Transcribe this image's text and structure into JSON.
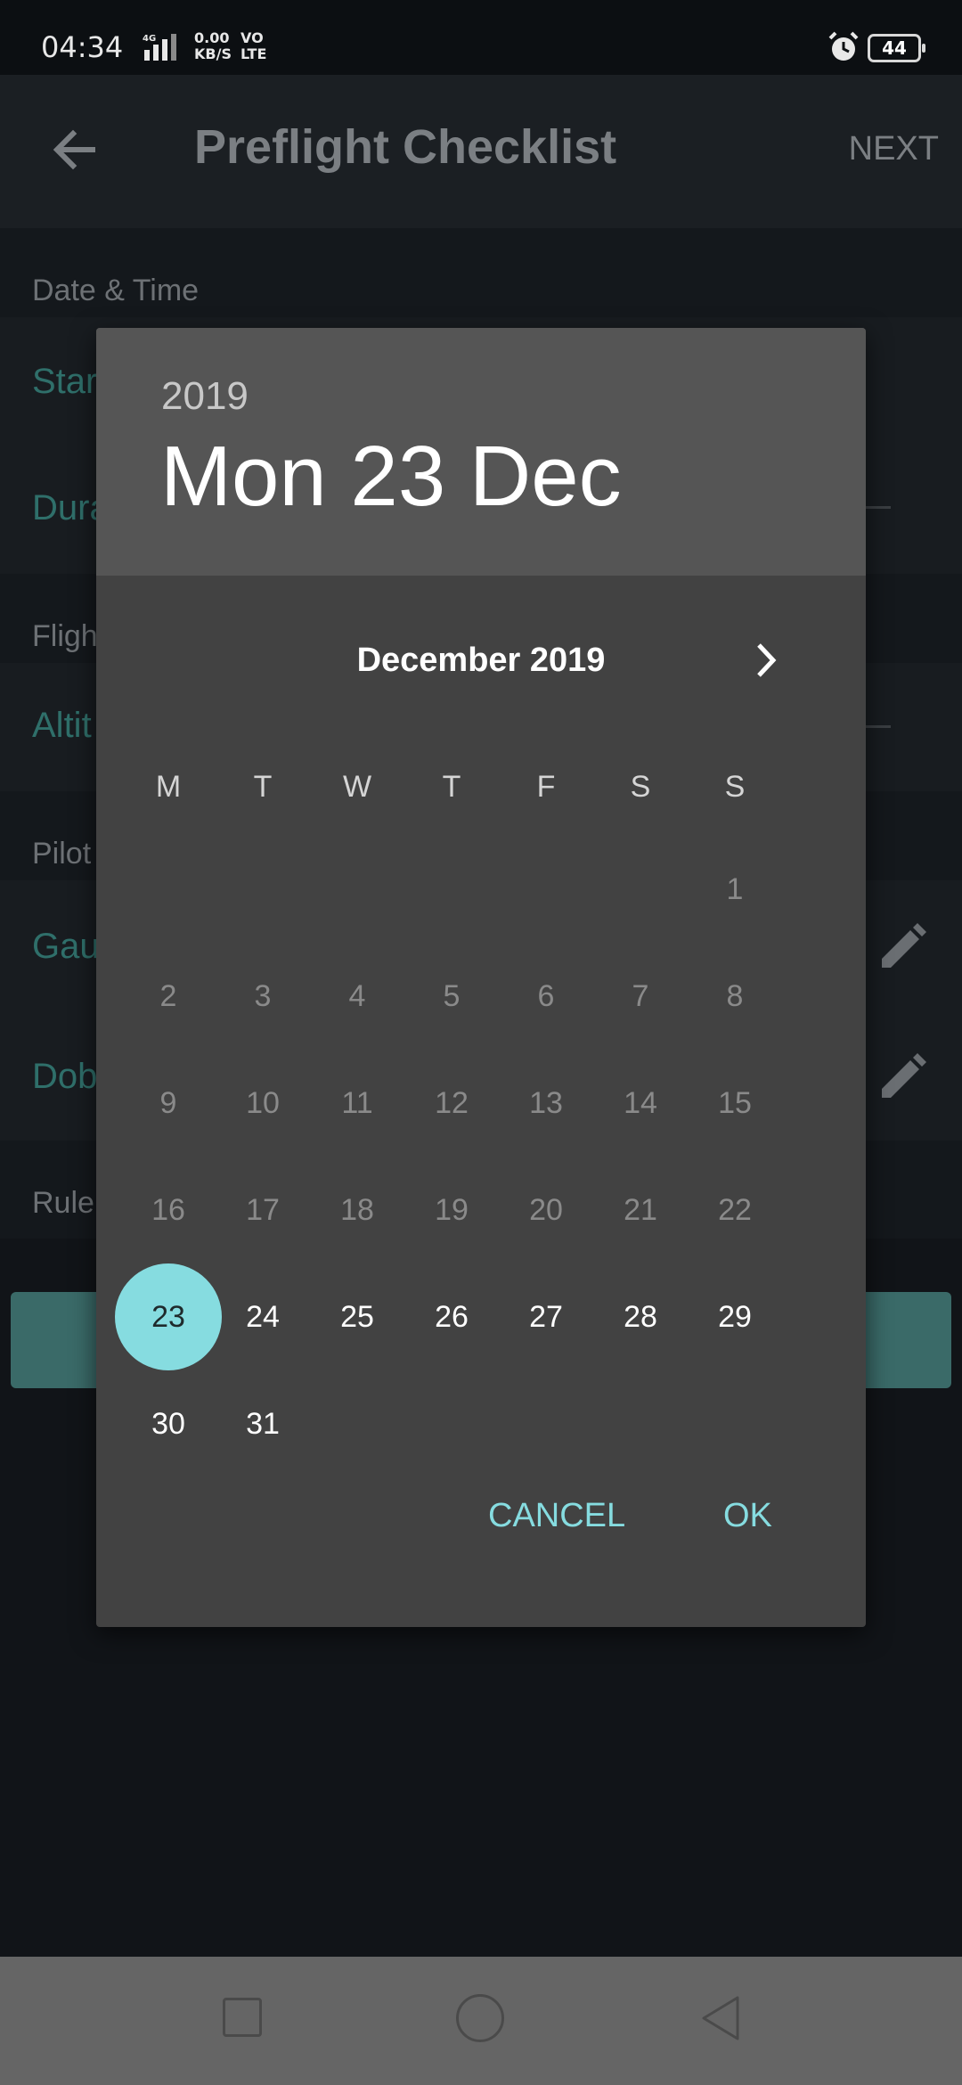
{
  "status_bar": {
    "time": "04:34",
    "network": "4G",
    "speed": "0.00\nKB/S",
    "volte": "VO\nLTE",
    "battery": "44"
  },
  "app_bar": {
    "title": "Preflight Checklist",
    "next_label": "NEXT"
  },
  "background": {
    "sections": [
      "Date & Time",
      "Fligh",
      "Pilot",
      "Rule"
    ],
    "rows": [
      "Star",
      "Dura",
      "Altit",
      "Gau",
      "Dob"
    ]
  },
  "date_picker": {
    "year": "2019",
    "selected_date": "Mon 23 Dec",
    "month_label": "December 2019",
    "weekdays": [
      "M",
      "T",
      "W",
      "T",
      "F",
      "S",
      "S"
    ],
    "selected_day": 23,
    "first_day_column": 6,
    "days_in_month": 31,
    "cancel_label": "CANCEL",
    "ok_label": "OK",
    "accent_color": "#86dce0"
  }
}
